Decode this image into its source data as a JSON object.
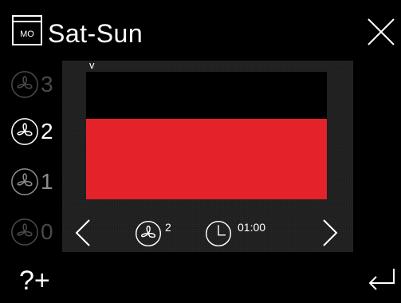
{
  "header": {
    "calendar_icon_label": "MO",
    "title": "Sat-Sun",
    "close_icon": "close-icon"
  },
  "levels": [
    {
      "label": "3",
      "state": "dim"
    },
    {
      "label": "2",
      "state": "active"
    },
    {
      "label": "1",
      "state": "mid"
    },
    {
      "label": "0",
      "state": "dim"
    }
  ],
  "schedule": {
    "marker": "v",
    "fan_level": 2,
    "bar_color": "#e4222a",
    "fan_setting_label": "2",
    "time_label": "01:00"
  },
  "footer": {
    "help_label": "?+",
    "enter_icon": "enter-icon"
  }
}
